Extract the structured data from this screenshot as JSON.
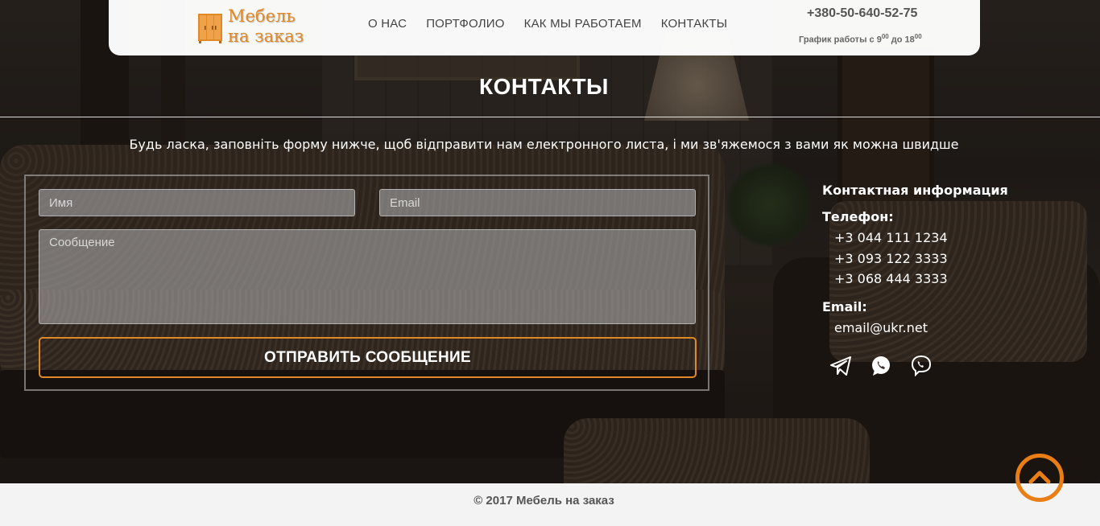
{
  "header": {
    "logo_line1": "Мебель",
    "logo_line2": "на заказ",
    "nav": [
      "О НАС",
      "ПОРТФОЛИО",
      "КАК МЫ РАБОТАЕМ",
      "КОНТАКТЫ"
    ],
    "phone": "+380-50-640-52-75",
    "hours_prefix": "График работы с 9",
    "hours_sup1": "00",
    "hours_mid": " до 18",
    "hours_sup2": "00"
  },
  "section": {
    "title": "КОНТАКТЫ",
    "intro": "Будь ласка, заповніть форму нижче, щоб відправити нам електронного листа, і ми зв'яжемося з вами як можна швидше"
  },
  "form": {
    "name_placeholder": "Имя",
    "name_value": "",
    "email_placeholder": "Email",
    "email_value": "",
    "message_placeholder": "Сообщение",
    "message_value": "",
    "submit_label": "ОТПРАВИТЬ СООБЩЕНИЕ"
  },
  "contacts": {
    "heading": "Контактная информация",
    "phone_label": "Телефон:",
    "phones": [
      "+3 044 111 1234",
      "+3 093 122 3333",
      "+3 068 444 3333"
    ],
    "email_label": "Email:",
    "email": "email@ukr.net",
    "socials": [
      "telegram-icon",
      "whatsapp-icon",
      "viber-icon"
    ]
  },
  "footer": {
    "copyright": "© 2017 Мебель на заказ"
  },
  "colors": {
    "accent": "#e08a27",
    "scroll_top": "#e97e14",
    "footer_bg": "#f3f3f3"
  }
}
